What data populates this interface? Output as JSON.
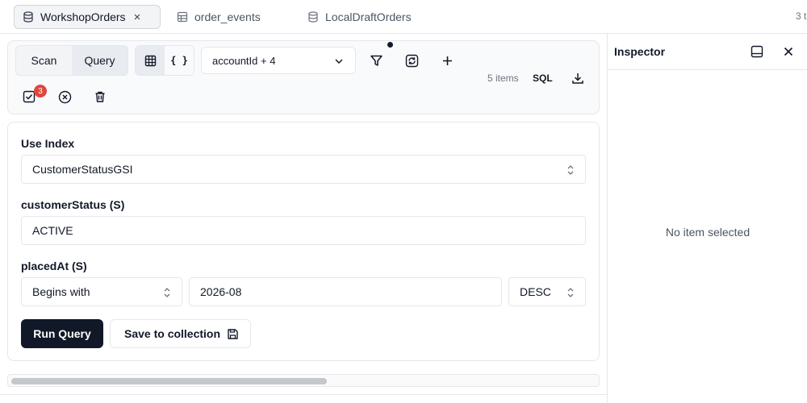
{
  "tabs": [
    {
      "label": "WorkshopOrders",
      "active": true,
      "icon": "database-icon"
    },
    {
      "label": "order_events",
      "active": false,
      "icon": "table-icon"
    },
    {
      "label": "LocalDraftOrders",
      "active": false,
      "icon": "database-icon"
    }
  ],
  "tab_count_text": "3 t",
  "toolbar": {
    "mode_scan": "Scan",
    "mode_query": "Query",
    "view_json_label": "{ }",
    "attribute_select": "accountId + 4",
    "items_count": "5 items",
    "sql_label": "SQL",
    "selected_badge": "3"
  },
  "form": {
    "index_label": "Use Index",
    "index_value": "CustomerStatusGSI",
    "pk_label": "customerStatus (S)",
    "pk_value": "ACTIVE",
    "sk_label": "placedAt (S)",
    "sk_operator": "Begins with",
    "sk_value": "2026-08",
    "sort_order": "DESC",
    "run_button": "Run Query",
    "save_button": "Save to collection"
  },
  "scroll": {
    "thumb_fraction": 0.54
  },
  "inspector": {
    "title": "Inspector",
    "empty_text": "No item selected"
  },
  "colors": {
    "primary_button": "#111827",
    "badge": "#e0473c",
    "border": "#e5e7eb"
  }
}
